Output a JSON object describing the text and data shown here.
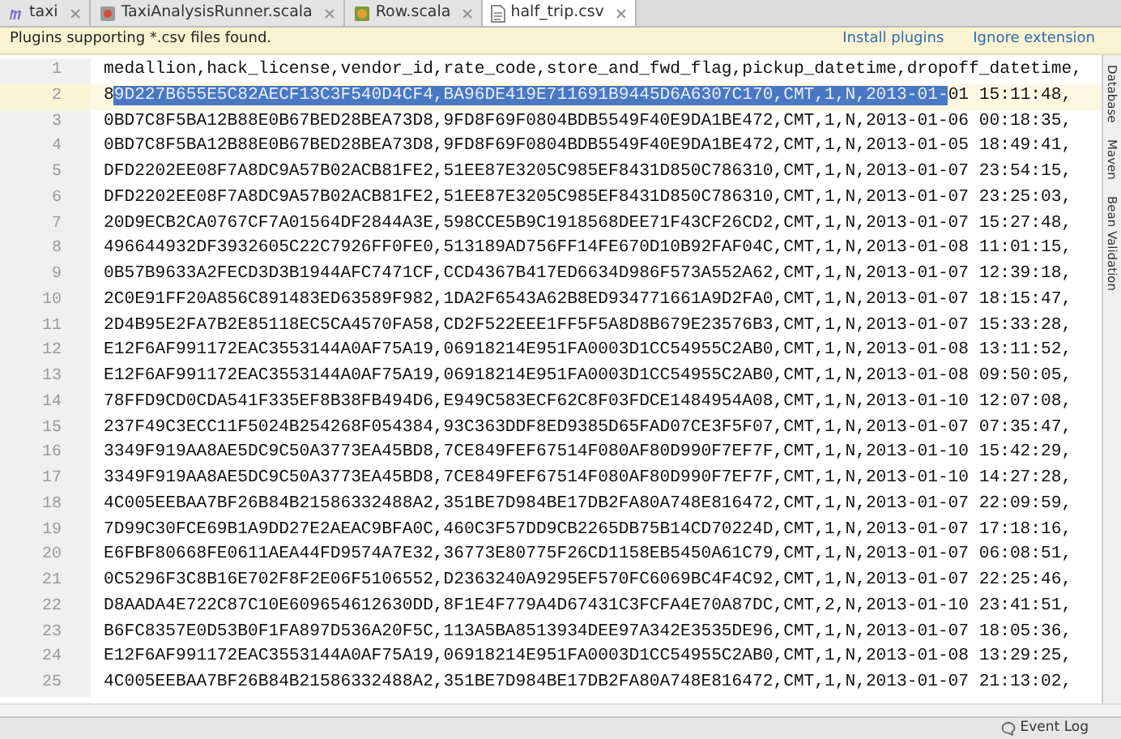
{
  "tabs": [
    {
      "label": "taxi",
      "kind": "module",
      "selected": false
    },
    {
      "label": "TaxiAnalysisRunner.scala",
      "kind": "scala-object",
      "selected": false
    },
    {
      "label": "Row.scala",
      "kind": "scala-class",
      "selected": false
    },
    {
      "label": "half_trip.csv",
      "kind": "csv",
      "selected": true
    }
  ],
  "notification": {
    "message": "Plugins supporting *.csv files found.",
    "actions": [
      "Install plugins",
      "Ignore extension"
    ]
  },
  "editor": {
    "lines": [
      {
        "number": "1",
        "current": false,
        "text": "medallion,hack_license,vendor_id,rate_code,store_and_fwd_flag,pickup_datetime,dropoff_datetime,"
      },
      {
        "number": "2",
        "current": true,
        "before": "8",
        "selection": "9D227B655E5C82AECF13C3F540D4CF4,BA96DE419E711691B9445D6A6307C170,CMT,1,N,2013-01-",
        "after": "01 15:11:48,"
      },
      {
        "number": "3",
        "current": false,
        "text": "0BD7C8F5BA12B88E0B67BED28BEA73D8,9FD8F69F0804BDB5549F40E9DA1BE472,CMT,1,N,2013-01-06 00:18:35,"
      },
      {
        "number": "4",
        "current": false,
        "text": "0BD7C8F5BA12B88E0B67BED28BEA73D8,9FD8F69F0804BDB5549F40E9DA1BE472,CMT,1,N,2013-01-05 18:49:41,"
      },
      {
        "number": "5",
        "current": false,
        "text": "DFD2202EE08F7A8DC9A57B02ACB81FE2,51EE87E3205C985EF8431D850C786310,CMT,1,N,2013-01-07 23:54:15,"
      },
      {
        "number": "6",
        "current": false,
        "text": "DFD2202EE08F7A8DC9A57B02ACB81FE2,51EE87E3205C985EF8431D850C786310,CMT,1,N,2013-01-07 23:25:03,"
      },
      {
        "number": "7",
        "current": false,
        "text": "20D9ECB2CA0767CF7A01564DF2844A3E,598CCE5B9C1918568DEE71F43CF26CD2,CMT,1,N,2013-01-07 15:27:48,"
      },
      {
        "number": "8",
        "current": false,
        "text": "496644932DF3932605C22C7926FF0FE0,513189AD756FF14FE670D10B92FAF04C,CMT,1,N,2013-01-08 11:01:15,"
      },
      {
        "number": "9",
        "current": false,
        "text": "0B57B9633A2FECD3D3B1944AFC7471CF,CCD4367B417ED6634D986F573A552A62,CMT,1,N,2013-01-07 12:39:18,"
      },
      {
        "number": "10",
        "current": false,
        "text": "2C0E91FF20A856C891483ED63589F982,1DA2F6543A62B8ED934771661A9D2FA0,CMT,1,N,2013-01-07 18:15:47,"
      },
      {
        "number": "11",
        "current": false,
        "text": "2D4B95E2FA7B2E85118EC5CA4570FA58,CD2F522EEE1FF5F5A8D8B679E23576B3,CMT,1,N,2013-01-07 15:33:28,"
      },
      {
        "number": "12",
        "current": false,
        "text": "E12F6AF991172EAC3553144A0AF75A19,06918214E951FA0003D1CC54955C2AB0,CMT,1,N,2013-01-08 13:11:52,"
      },
      {
        "number": "13",
        "current": false,
        "text": "E12F6AF991172EAC3553144A0AF75A19,06918214E951FA0003D1CC54955C2AB0,CMT,1,N,2013-01-08 09:50:05,"
      },
      {
        "number": "14",
        "current": false,
        "text": "78FFD9CD0CDA541F335EF8B38FB494D6,E949C583ECF62C8F03FDCE1484954A08,CMT,1,N,2013-01-10 12:07:08,"
      },
      {
        "number": "15",
        "current": false,
        "text": "237F49C3ECC11F5024B254268F054384,93C363DDF8ED9385D65FAD07CE3F5F07,CMT,1,N,2013-01-07 07:35:47,"
      },
      {
        "number": "16",
        "current": false,
        "text": "3349F919AA8AE5DC9C50A3773EA45BD8,7CE849FEF67514F080AF80D990F7EF7F,CMT,1,N,2013-01-10 15:42:29,"
      },
      {
        "number": "17",
        "current": false,
        "text": "3349F919AA8AE5DC9C50A3773EA45BD8,7CE849FEF67514F080AF80D990F7EF7F,CMT,1,N,2013-01-10 14:27:28,"
      },
      {
        "number": "18",
        "current": false,
        "text": "4C005EEBAA7BF26B84B21586332488A2,351BE7D984BE17DB2FA80A748E816472,CMT,1,N,2013-01-07 22:09:59,"
      },
      {
        "number": "19",
        "current": false,
        "text": "7D99C30FCE69B1A9DD27E2AEAC9BFA0C,460C3F57DD9CB2265DB75B14CD70224D,CMT,1,N,2013-01-07 17:18:16,"
      },
      {
        "number": "20",
        "current": false,
        "text": "E6FBF80668FE0611AEA44FD9574A7E32,36773E80775F26CD1158EB5450A61C79,CMT,1,N,2013-01-07 06:08:51,"
      },
      {
        "number": "21",
        "current": false,
        "text": "0C5296F3C8B16E702F8F2E06F5106552,D2363240A9295EF570FC6069BC4F4C92,CMT,1,N,2013-01-07 22:25:46,"
      },
      {
        "number": "22",
        "current": false,
        "text": "D8AADA4E722C87C10E609654612630DD,8F1E4F779A4D67431C3FCFA4E70A87DC,CMT,2,N,2013-01-10 23:41:51,"
      },
      {
        "number": "23",
        "current": false,
        "text": "B6FC8357E0D53B0F1FA897D536A20F5C,113A5BA8513934DEE97A342E3535DE96,CMT,1,N,2013-01-07 18:05:36,"
      },
      {
        "number": "24",
        "current": false,
        "text": "E12F6AF991172EAC3553144A0AF75A19,06918214E951FA0003D1CC54955C2AB0,CMT,1,N,2013-01-08 13:29:25,"
      },
      {
        "number": "25",
        "current": false,
        "text": "4C005EEBAA7BF26B84B21586332488A2,351BE7D984BE17DB2FA80A748E816472,CMT,1,N,2013-01-07 21:13:02,"
      }
    ]
  },
  "side_panels": [
    "Database",
    "Maven",
    "Bean Validation"
  ],
  "status_bar": {
    "event_log": "Event Log"
  }
}
